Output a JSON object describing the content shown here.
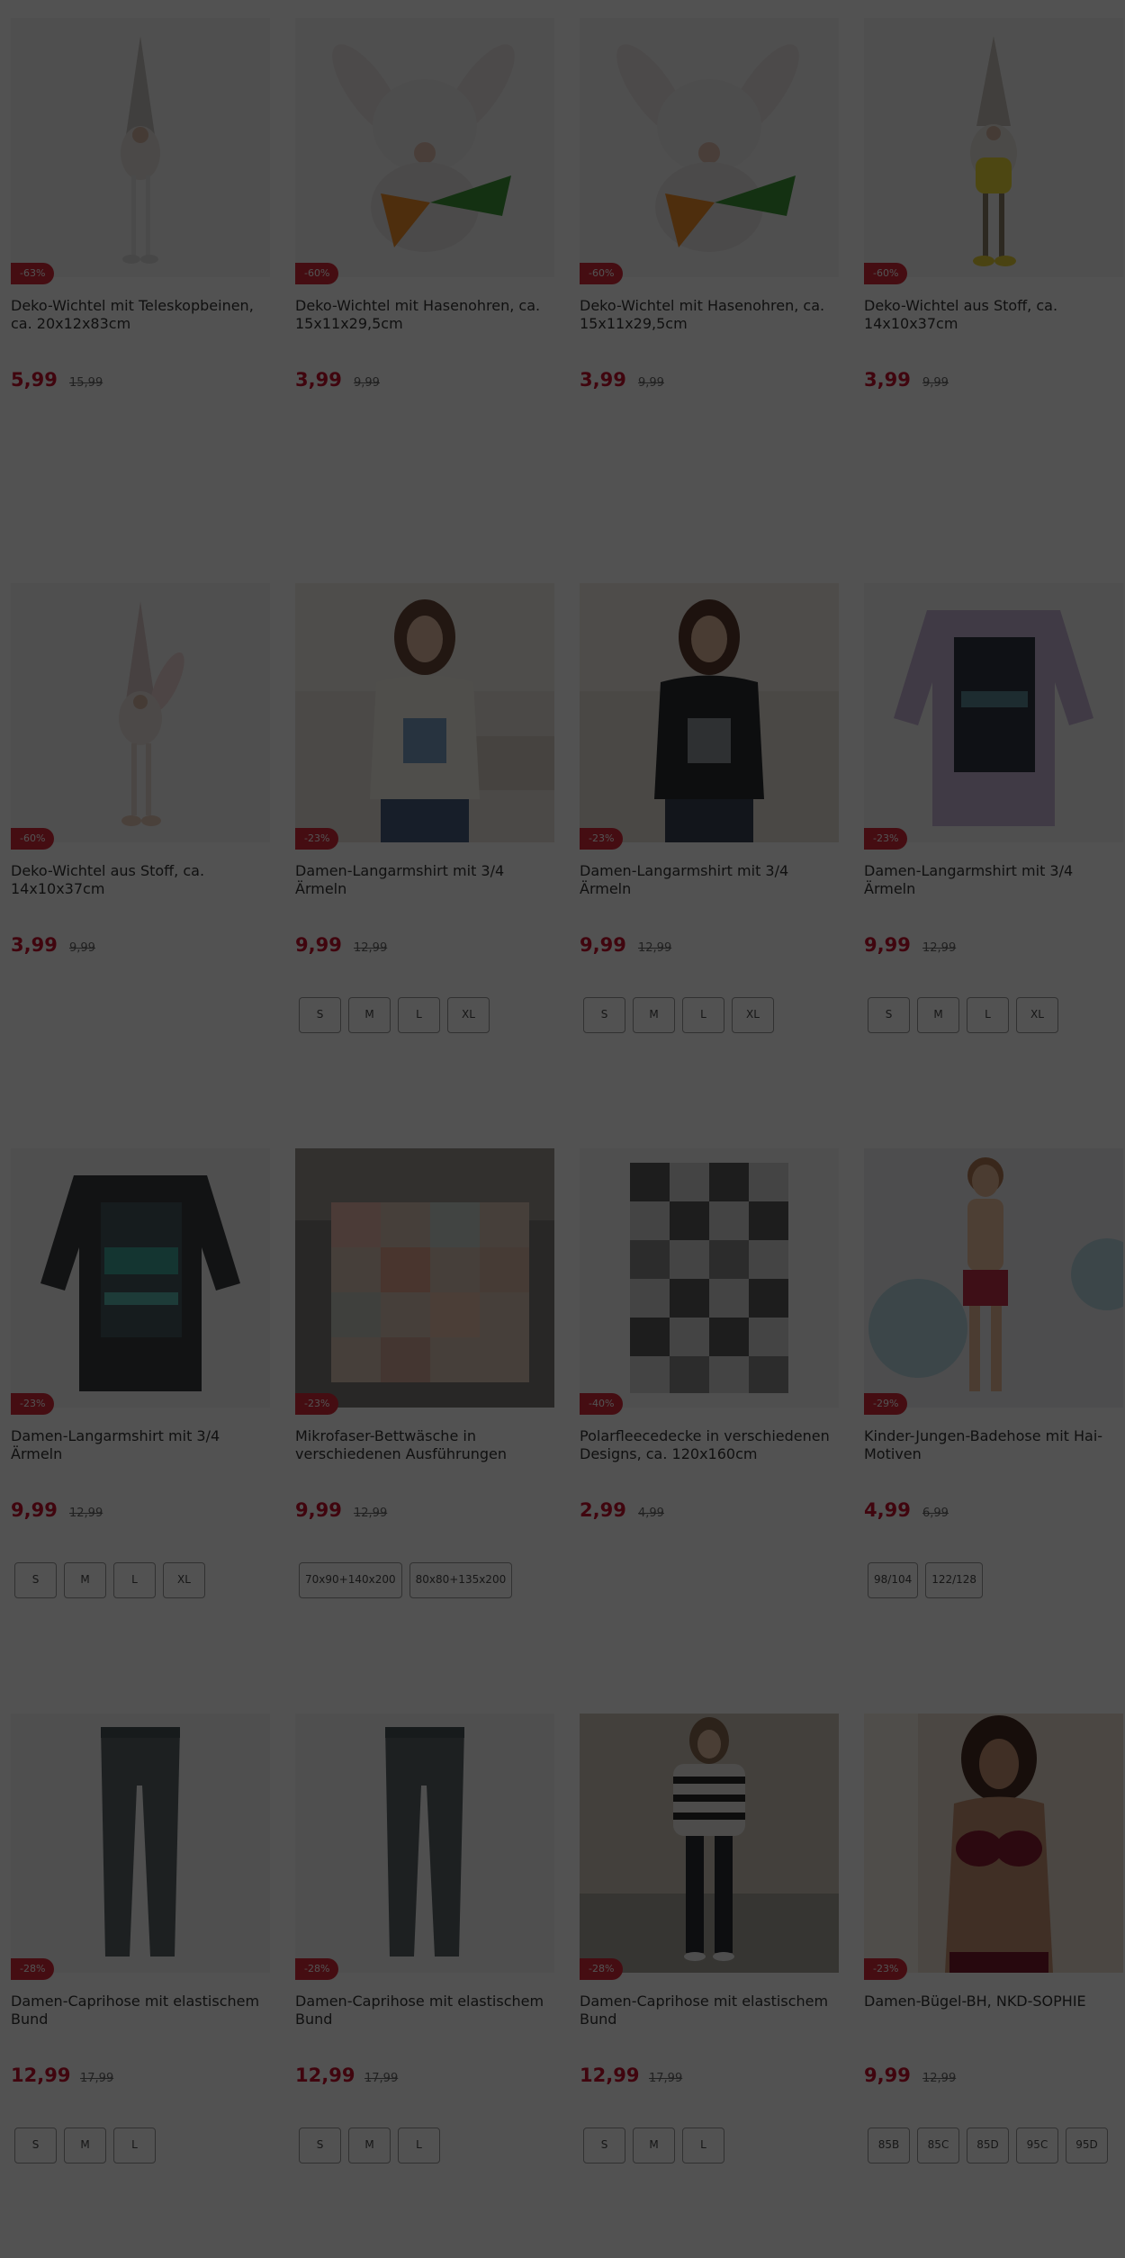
{
  "products": [
    {
      "title": "Deko-Wichtel mit Teleskopbeinen, ca. 20x12x83cm",
      "price": "5,99",
      "old_price": "15,99",
      "discount": "-63%",
      "sizes": [],
      "image": "gnome-tall-icon"
    },
    {
      "title": "Deko-Wichtel mit Hasenohren, ca. 15x11x29,5cm",
      "price": "3,99",
      "old_price": "9,99",
      "discount": "-60%",
      "sizes": [],
      "image": "bunny-gnome-carrot-icon"
    },
    {
      "title": "Deko-Wichtel mit Hasenohren, ca. 15x11x29,5cm",
      "price": "3,99",
      "old_price": "9,99",
      "discount": "-60%",
      "sizes": [],
      "image": "bunny-gnome-carrot-icon"
    },
    {
      "title": "Deko-Wichtel aus Stoff, ca. 14x10x37cm",
      "price": "3,99",
      "old_price": "9,99",
      "discount": "-60%",
      "sizes": [],
      "image": "gnome-yellow-icon"
    },
    {
      "title": "Deko-Wichtel aus Stoff, ca. 14x10x37cm",
      "price": "3,99",
      "old_price": "9,99",
      "discount": "-60%",
      "sizes": [],
      "image": "bunny-gnome-icon"
    },
    {
      "title": "Damen-Langarmshirt mit 3/4 Ärmeln",
      "price": "9,99",
      "old_price": "12,99",
      "discount": "-23%",
      "sizes": [
        "S",
        "M",
        "L",
        "XL"
      ],
      "image": "woman-white-shirt-icon"
    },
    {
      "title": "Damen-Langarmshirt mit 3/4 Ärmeln",
      "price": "9,99",
      "old_price": "12,99",
      "discount": "-23%",
      "sizes": [
        "S",
        "M",
        "L",
        "XL"
      ],
      "image": "woman-black-shirt-icon"
    },
    {
      "title": "Damen-Langarmshirt mit 3/4 Ärmeln",
      "price": "9,99",
      "old_price": "12,99",
      "discount": "-23%",
      "sizes": [
        "S",
        "M",
        "L",
        "XL"
      ],
      "image": "lilac-shirt-icon"
    },
    {
      "title": "Damen-Langarmshirt mit 3/4 Ärmeln",
      "price": "9,99",
      "old_price": "12,99",
      "discount": "-23%",
      "sizes": [
        "S",
        "M",
        "L",
        "XL"
      ],
      "image": "dark-shirt-icon"
    },
    {
      "title": "Mikrofaser-Bettwäsche in verschiedenen Ausführungen",
      "price": "9,99",
      "old_price": "12,99",
      "discount": "-23%",
      "sizes": [
        "70x90+140x200",
        "80x80+135x200"
      ],
      "image": "bed-linen-icon"
    },
    {
      "title": "Polarfleecedecke in verschiedenen Designs, ca. 120x160cm",
      "price": "2,99",
      "old_price": "4,99",
      "discount": "-40%",
      "sizes": [],
      "image": "checkered-blanket-icon"
    },
    {
      "title": "Kinder-Jungen-Badehose mit Hai-Motiven",
      "price": "4,99",
      "old_price": "6,99",
      "discount": "-29%",
      "sizes": [
        "98/104",
        "122/128"
      ],
      "image": "boy-swim-trunks-icon"
    },
    {
      "title": "Damen-Caprihose mit elastischem Bund",
      "price": "12,99",
      "old_price": "17,99",
      "discount": "-28%",
      "sizes": [
        "S",
        "M",
        "L"
      ],
      "image": "leggings-icon"
    },
    {
      "title": "Damen-Caprihose mit elastischem Bund",
      "price": "12,99",
      "old_price": "17,99",
      "discount": "-28%",
      "sizes": [
        "S",
        "M",
        "L"
      ],
      "image": "leggings-icon"
    },
    {
      "title": "Damen-Caprihose mit elastischem Bund",
      "price": "12,99",
      "old_price": "17,99",
      "discount": "-28%",
      "sizes": [
        "S",
        "M",
        "L"
      ],
      "image": "woman-striped-sweater-icon"
    },
    {
      "title": "Damen-Bügel-BH, NKD-SOPHIE",
      "price": "9,99",
      "old_price": "12,99",
      "discount": "-23%",
      "sizes": [
        "85B",
        "85C",
        "85D",
        "95C",
        "95D"
      ],
      "image": "woman-red-bra-icon"
    }
  ],
  "colors": {
    "discount_badge": "#d52b3a",
    "price": "#c8102e",
    "overlay": "rgba(0,0,0,0.68)"
  }
}
